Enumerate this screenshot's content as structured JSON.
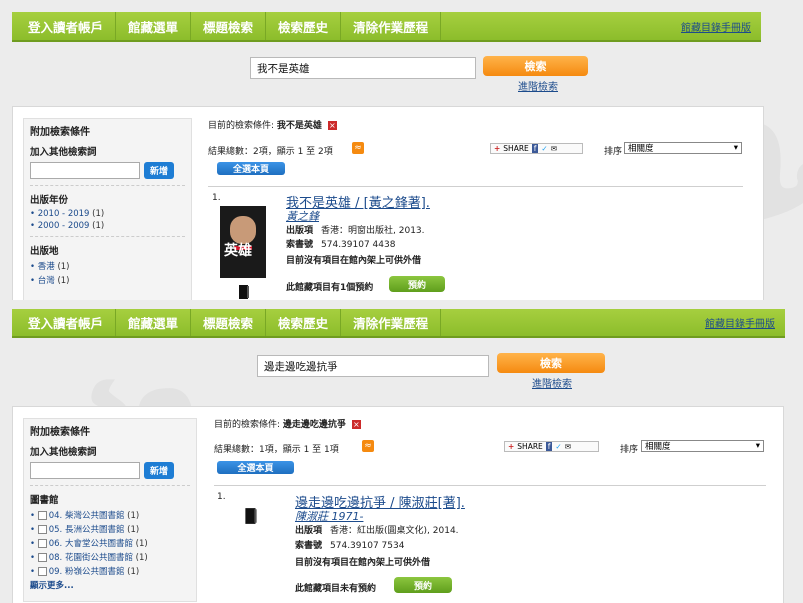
{
  "nav": {
    "items": [
      "登入讀者帳戶",
      "館藏選單",
      "標題檢索",
      "檢索歷史",
      "清除作業歷程"
    ],
    "help_link": "館藏目錄手冊版"
  },
  "search": {
    "button": "檢索",
    "advanced": "進階檢索"
  },
  "sidebar": {
    "title": "附加檢索條件",
    "add_label": "加入其他檢索詞",
    "add_button": "新增"
  },
  "results": {
    "criteria_label": "目前的檢索條件:",
    "select_all": "全選本頁",
    "sort_label": "排序",
    "sort_value": "相關度",
    "share_label": "SHARE",
    "pub_label": "出版項",
    "callno_label": "索書號",
    "availability": "目前沒有項目在館內架上可供外借",
    "reserve_button": "預約"
  },
  "shot1": {
    "query": "我不是英雄",
    "criteria_value": "我不是英雄",
    "count_text": "結果總數：2項，顯示 1 至 2項",
    "facets": [
      {
        "heading": "出版年份",
        "items": [
          {
            "label": "2010 - 2019",
            "count": "(1)"
          },
          {
            "label": "2000 - 2009",
            "count": "(1)"
          }
        ]
      },
      {
        "heading": "出版地",
        "items": [
          {
            "label": "香港",
            "count": "(1)"
          },
          {
            "label": "台灣",
            "count": "(1)"
          }
        ]
      }
    ],
    "record": {
      "number": "1.",
      "title": "我不是英雄 / [黃之鋒著].",
      "author": "黃之鋒",
      "pub": "香港：明窗出版社, 2013.",
      "callno": "574.39107 4438",
      "holds": "此館藏項目有1個預約",
      "cover_text": "英雄"
    }
  },
  "shot2": {
    "query": "邊走邊吃邊抗爭",
    "criteria_value": "邊走邊吃邊抗爭",
    "count_text": "結果總數：1項，顯示 1 至 1項",
    "facet_heading": "圖書館",
    "libraries": [
      {
        "label": "04. 柴灣公共圖書館",
        "count": "(1)"
      },
      {
        "label": "05. 長洲公共圖書館",
        "count": "(1)"
      },
      {
        "label": "06. 大會堂公共圖書館",
        "count": "(1)"
      },
      {
        "label": "08. 花園街公共圖書館",
        "count": "(1)"
      },
      {
        "label": "09. 粉嶺公共圖書館",
        "count": "(1)"
      }
    ],
    "show_more": "顯示更多...",
    "record": {
      "number": "1.",
      "title": "邊走邊吃邊抗爭 / 陳淑莊[著].",
      "author": "陳淑莊 1971-",
      "pub": "香港：紅出版(圓桌文化), 2014.",
      "callno": "574.39107 7534",
      "holds": "此館藏項目未有預約"
    }
  }
}
